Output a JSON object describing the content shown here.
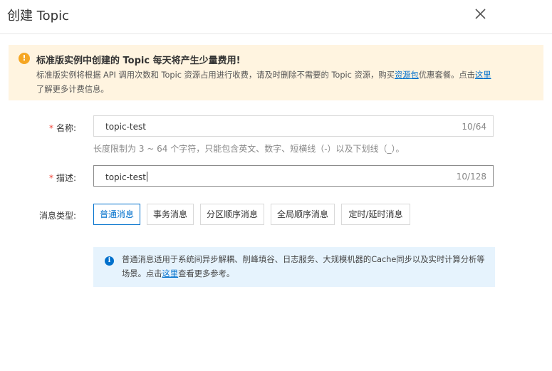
{
  "dialog": {
    "title": "创建 Topic"
  },
  "warning": {
    "title": "标准版实例中创建的 Topic 每天将产生少量费用!",
    "body_part1": "标准版实例将根据 API 调用次数和 Topic 资源占用进行收费，请及时删除不需要的 Topic 资源，购买",
    "link_package": "资源包",
    "body_part2": "优惠套餐。点击",
    "link_here": "这里",
    "body_part3": "了解更多计费信息。"
  },
  "form": {
    "name": {
      "required_mark": "*",
      "label": "名称:",
      "value": "topic-test",
      "counter": "10/64",
      "hint": "长度限制为 3 ~ 64 个字符，只能包含英文、数字、短横线（-）以及下划线（_）。"
    },
    "description": {
      "required_mark": "*",
      "label": "描述:",
      "value": "topic-test",
      "counter": "10/128"
    },
    "message_type": {
      "label": "消息类型:",
      "options": [
        "普通消息",
        "事务消息",
        "分区顺序消息",
        "全局顺序消息",
        "定时/延时消息"
      ],
      "selected": "普通消息"
    }
  },
  "info": {
    "text_part1": "普通消息适用于系统间异步解耦、削峰填谷、日志服务、大规模机器的Cache同步以及实时计算分析等场景。点击",
    "link_here": "这里",
    "text_part2": "查看更多参考。"
  },
  "colors": {
    "accent": "#0070cc",
    "warning_bg": "#fff4e0",
    "warning_icon": "#f5a623",
    "info_bg": "#e6f3fd",
    "required": "#f04134"
  }
}
